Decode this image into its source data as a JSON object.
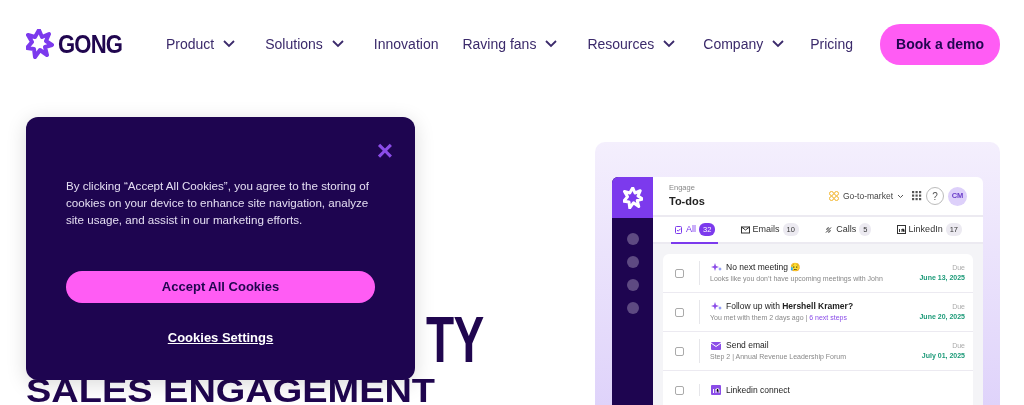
{
  "logo": {
    "text": "GONG"
  },
  "nav": [
    {
      "label": "Product",
      "dropdown": true
    },
    {
      "label": "Solutions",
      "dropdown": true
    },
    {
      "label": "Innovation",
      "dropdown": false
    },
    {
      "label": "Raving fans",
      "dropdown": true
    },
    {
      "label": "Resources",
      "dropdown": true
    },
    {
      "label": "Company",
      "dropdown": true
    },
    {
      "label": "Pricing",
      "dropdown": false
    }
  ],
  "cta": "Book a demo",
  "hero": {
    "lines": [
      "TY",
      "SALES ENGAGEMENT"
    ]
  },
  "cookie": {
    "text": "By clicking “Accept All Cookies”, you agree to the storing of cookies on your device to enhance site navigation, analyze site usage, and assist in our marketing efforts.",
    "accept": "Accept All Cookies",
    "settings": "Cookies Settings",
    "close": "×"
  },
  "app": {
    "section": "Engage",
    "title": "To-dos",
    "workspace": "Go-to-market",
    "help": "?",
    "avatar": "CM",
    "tabs": [
      {
        "label": "All",
        "count": "32",
        "kind": "all",
        "selected": true
      },
      {
        "label": "Emails",
        "count": "10",
        "kind": "email",
        "selected": false
      },
      {
        "label": "Calls",
        "count": "5",
        "kind": "call",
        "selected": false
      },
      {
        "label": "LinkedIn",
        "count": "17",
        "kind": "linkedin",
        "selected": false
      }
    ],
    "tasks": [
      {
        "kind": "ai",
        "title": "No next meeting 😥",
        "subtitle": "Looks like you don’t have upcoming meetings with John",
        "due_label": "Due",
        "due": "June 13, 2025",
        "checked": false
      },
      {
        "kind": "ai",
        "title": "Follow up with **Hershell Kramer?**",
        "subtitle": "You met with them 2 days ago |",
        "link": "6 next steps",
        "due_label": "Due",
        "due": "June 20, 2025",
        "checked": false
      },
      {
        "kind": "email",
        "title": "Send email",
        "subtitle": "Step 2 | Annual Revenue Leadership Forum",
        "due_label": "Due",
        "due": "July 01, 2025",
        "checked": false
      },
      {
        "kind": "linkedin",
        "title": "Linkedin connect",
        "checked": false
      }
    ]
  }
}
